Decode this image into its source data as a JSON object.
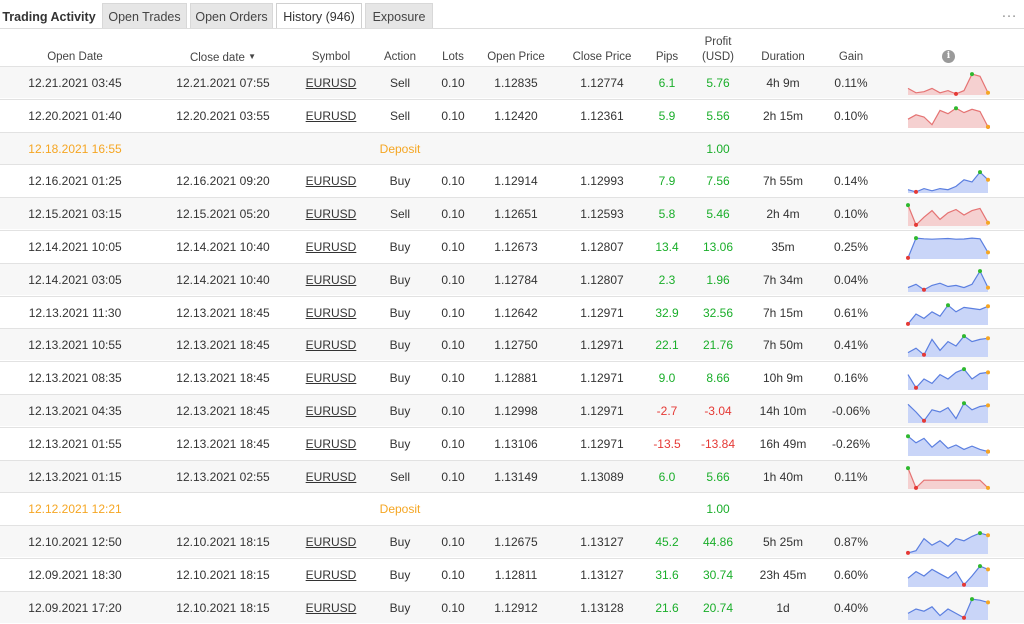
{
  "tabs": [
    {
      "label": "Trading Activity"
    },
    {
      "label": "Open Trades"
    },
    {
      "label": "Open Orders"
    },
    {
      "label": "History (946)"
    },
    {
      "label": "Exposure"
    }
  ],
  "more_icon": "…",
  "headers": {
    "open_date": "Open Date",
    "close_date": "Close date",
    "sort_indicator": "▼",
    "symbol": "Symbol",
    "action": "Action",
    "lots": "Lots",
    "open_price": "Open Price",
    "close_price": "Close Price",
    "pips": "Pips",
    "profit_line1": "Profit",
    "profit_line2": "(USD)",
    "duration": "Duration",
    "gain": "Gain",
    "info_icon": "i"
  },
  "colors": {
    "positive": "#1aae2a",
    "negative": "#e53935",
    "deposit": "#f5a623",
    "spark_buy_stroke": "#5b7fe0",
    "spark_buy_fill": "#c9d5f8",
    "spark_sell_stroke": "#e57373",
    "spark_sell_fill": "#f5d0d0"
  },
  "rows": [
    {
      "type": "trade",
      "open_date": "12.21.2021 03:45",
      "close_date": "12.21.2021 07:55",
      "symbol": "EURUSD",
      "action": "Sell",
      "lots": "0.10",
      "open_price": "1.12835",
      "close_price": "1.12774",
      "pips": "6.1",
      "profit": "5.76",
      "duration": "4h 9m",
      "gain": "0.11%",
      "spark": [
        0.3,
        0.1,
        0.15,
        0.3,
        0.1,
        0.2,
        0.05,
        0.2,
        0.95,
        0.85,
        0.1
      ]
    },
    {
      "type": "trade",
      "open_date": "12.20.2021 01:40",
      "close_date": "12.20.2021 03:55",
      "symbol": "EURUSD",
      "action": "Sell",
      "lots": "0.10",
      "open_price": "1.12420",
      "close_price": "1.12361",
      "pips": "5.9",
      "profit": "5.56",
      "duration": "2h 15m",
      "gain": "0.10%",
      "spark": [
        0.4,
        0.6,
        0.5,
        0.15,
        0.8,
        0.65,
        0.9,
        0.7,
        0.85,
        0.75,
        0.05
      ]
    },
    {
      "type": "deposit",
      "date": "12.18.2021 16:55",
      "label": "Deposit",
      "profit": "1.00"
    },
    {
      "type": "trade",
      "open_date": "12.16.2021 01:25",
      "close_date": "12.16.2021 09:20",
      "symbol": "EURUSD",
      "action": "Buy",
      "lots": "0.10",
      "open_price": "1.12914",
      "close_price": "1.12993",
      "pips": "7.9",
      "profit": "7.56",
      "duration": "7h 55m",
      "gain": "0.14%",
      "spark": [
        0.15,
        0.05,
        0.2,
        0.1,
        0.2,
        0.15,
        0.3,
        0.6,
        0.5,
        0.95,
        0.6
      ]
    },
    {
      "type": "trade",
      "open_date": "12.15.2021 03:15",
      "close_date": "12.15.2021 05:20",
      "symbol": "EURUSD",
      "action": "Sell",
      "lots": "0.10",
      "open_price": "1.12651",
      "close_price": "1.12593",
      "pips": "5.8",
      "profit": "5.46",
      "duration": "2h 4m",
      "gain": "0.10%",
      "spark": [
        0.95,
        0.05,
        0.4,
        0.7,
        0.3,
        0.6,
        0.75,
        0.5,
        0.7,
        0.8,
        0.15
      ]
    },
    {
      "type": "trade",
      "open_date": "12.14.2021 10:05",
      "close_date": "12.14.2021 10:40",
      "symbol": "EURUSD",
      "action": "Buy",
      "lots": "0.10",
      "open_price": "1.12673",
      "close_price": "1.12807",
      "pips": "13.4",
      "profit": "13.06",
      "duration": "35m",
      "gain": "0.25%",
      "spark": [
        0.05,
        0.95,
        0.92,
        0.9,
        0.92,
        0.93,
        0.9,
        0.91,
        0.95,
        0.92,
        0.3
      ]
    },
    {
      "type": "trade",
      "open_date": "12.14.2021 03:05",
      "close_date": "12.14.2021 10:40",
      "symbol": "EURUSD",
      "action": "Buy",
      "lots": "0.10",
      "open_price": "1.12784",
      "close_price": "1.12807",
      "pips": "2.3",
      "profit": "1.96",
      "duration": "7h 34m",
      "gain": "0.04%",
      "spark": [
        0.2,
        0.35,
        0.1,
        0.3,
        0.4,
        0.25,
        0.3,
        0.2,
        0.35,
        0.95,
        0.2
      ]
    },
    {
      "type": "trade",
      "open_date": "12.13.2021 11:30",
      "close_date": "12.13.2021 18:45",
      "symbol": "EURUSD",
      "action": "Buy",
      "lots": "0.10",
      "open_price": "1.12642",
      "close_price": "1.12971",
      "pips": "32.9",
      "profit": "32.56",
      "duration": "7h 15m",
      "gain": "0.61%",
      "spark": [
        0.05,
        0.5,
        0.3,
        0.6,
        0.4,
        0.9,
        0.6,
        0.8,
        0.75,
        0.7,
        0.85
      ]
    },
    {
      "type": "trade",
      "open_date": "12.13.2021 10:55",
      "close_date": "12.13.2021 18:45",
      "symbol": "EURUSD",
      "action": "Buy",
      "lots": "0.10",
      "open_price": "1.12750",
      "close_price": "1.12971",
      "pips": "22.1",
      "profit": "21.76",
      "duration": "7h 50m",
      "gain": "0.41%",
      "spark": [
        0.2,
        0.4,
        0.1,
        0.8,
        0.3,
        0.7,
        0.5,
        0.95,
        0.7,
        0.8,
        0.85
      ]
    },
    {
      "type": "trade",
      "open_date": "12.13.2021 08:35",
      "close_date": "12.13.2021 18:45",
      "symbol": "EURUSD",
      "action": "Buy",
      "lots": "0.10",
      "open_price": "1.12881",
      "close_price": "1.12971",
      "pips": "9.0",
      "profit": "8.66",
      "duration": "10h 9m",
      "gain": "0.16%",
      "spark": [
        0.7,
        0.1,
        0.5,
        0.3,
        0.7,
        0.5,
        0.8,
        0.95,
        0.5,
        0.75,
        0.8
      ]
    },
    {
      "type": "trade",
      "open_date": "12.13.2021 04:35",
      "close_date": "12.13.2021 18:45",
      "symbol": "EURUSD",
      "action": "Buy",
      "lots": "0.10",
      "open_price": "1.12998",
      "close_price": "1.12971",
      "pips": "-2.7",
      "profit": "-3.04",
      "duration": "14h 10m",
      "gain": "-0.06%",
      "spark": [
        0.85,
        0.5,
        0.1,
        0.6,
        0.5,
        0.7,
        0.2,
        0.9,
        0.6,
        0.75,
        0.8
      ]
    },
    {
      "type": "trade",
      "open_date": "12.13.2021 01:55",
      "close_date": "12.13.2021 18:45",
      "symbol": "EURUSD",
      "action": "Buy",
      "lots": "0.10",
      "open_price": "1.13106",
      "close_price": "1.12971",
      "pips": "-13.5",
      "profit": "-13.84",
      "duration": "16h 49m",
      "gain": "-0.26%",
      "spark": [
        0.9,
        0.6,
        0.8,
        0.4,
        0.7,
        0.35,
        0.5,
        0.3,
        0.45,
        0.3,
        0.2
      ]
    },
    {
      "type": "trade",
      "open_date": "12.13.2021 01:15",
      "close_date": "12.13.2021 02:55",
      "symbol": "EURUSD",
      "action": "Sell",
      "lots": "0.10",
      "open_price": "1.13149",
      "close_price": "1.13089",
      "pips": "6.0",
      "profit": "5.66",
      "duration": "1h 40m",
      "gain": "0.11%",
      "spark": [
        0.95,
        0.05,
        0.4,
        0.4,
        0.4,
        0.4,
        0.4,
        0.4,
        0.4,
        0.4,
        0.05
      ]
    },
    {
      "type": "deposit",
      "date": "12.12.2021 12:21",
      "label": "Deposit",
      "profit": "1.00"
    },
    {
      "type": "trade",
      "open_date": "12.10.2021 12:50",
      "close_date": "12.10.2021 18:15",
      "symbol": "EURUSD",
      "action": "Buy",
      "lots": "0.10",
      "open_price": "1.12675",
      "close_price": "1.13127",
      "pips": "45.2",
      "profit": "44.86",
      "duration": "5h 25m",
      "gain": "0.87%",
      "spark": [
        0.05,
        0.15,
        0.7,
        0.4,
        0.6,
        0.35,
        0.7,
        0.6,
        0.8,
        0.95,
        0.85
      ]
    },
    {
      "type": "trade",
      "open_date": "12.09.2021 18:30",
      "close_date": "12.10.2021 18:15",
      "symbol": "EURUSD",
      "action": "Buy",
      "lots": "0.10",
      "open_price": "1.12811",
      "close_price": "1.13127",
      "pips": "31.6",
      "profit": "30.74",
      "duration": "23h 45m",
      "gain": "0.60%",
      "spark": [
        0.4,
        0.7,
        0.5,
        0.8,
        0.6,
        0.4,
        0.7,
        0.1,
        0.5,
        0.95,
        0.8
      ]
    },
    {
      "type": "trade",
      "open_date": "12.09.2021 17:20",
      "close_date": "12.10.2021 18:15",
      "symbol": "EURUSD",
      "action": "Buy",
      "lots": "0.10",
      "open_price": "1.12912",
      "close_price": "1.13128",
      "pips": "21.6",
      "profit": "20.74",
      "duration": "1d",
      "gain": "0.40%",
      "spark": [
        0.3,
        0.5,
        0.4,
        0.6,
        0.2,
        0.5,
        0.3,
        0.1,
        0.95,
        0.9,
        0.8
      ]
    }
  ]
}
